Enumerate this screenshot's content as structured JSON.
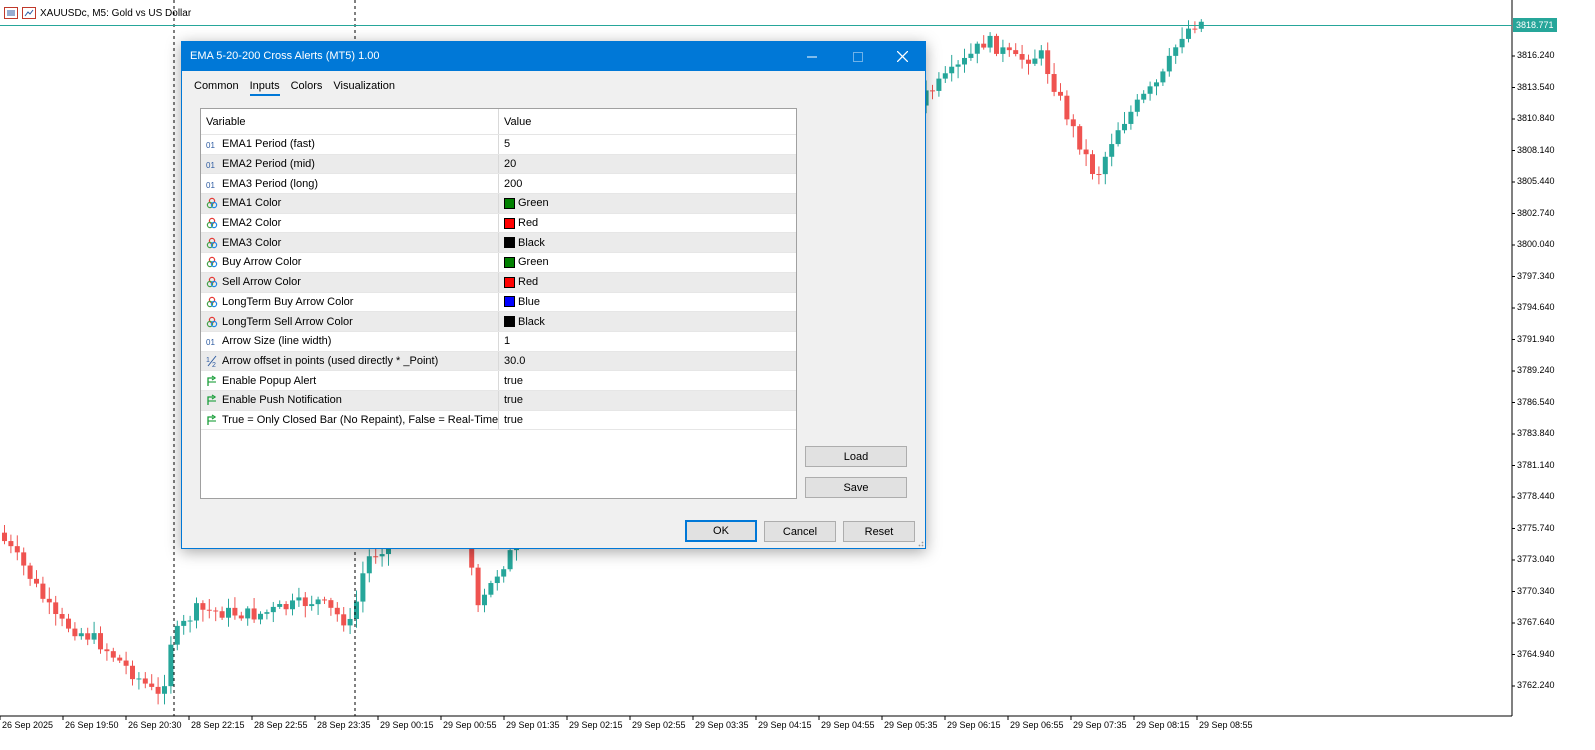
{
  "chart": {
    "title": "XAUUSDc, M5:  Gold vs US Dollar",
    "current_price": "3818.771",
    "price_axis": [
      "3816.240",
      "3813.540",
      "3810.840",
      "3808.140",
      "3805.440",
      "3802.740",
      "3800.040",
      "3797.340",
      "3794.640",
      "3791.940",
      "3789.240",
      "3786.540",
      "3783.840",
      "3781.140",
      "3778.440",
      "3775.740",
      "3773.040",
      "3770.340",
      "3767.640",
      "3764.940",
      "3762.240"
    ],
    "time_axis": [
      "26 Sep 2025",
      "26 Sep 19:50",
      "26 Sep 20:30",
      "28 Sep 22:15",
      "28 Sep 22:55",
      "28 Sep 23:35",
      "29 Sep 00:15",
      "29 Sep 00:55",
      "29 Sep 01:35",
      "29 Sep 02:15",
      "29 Sep 02:55",
      "29 Sep 03:35",
      "29 Sep 04:15",
      "29 Sep 04:55",
      "29 Sep 05:35",
      "29 Sep 06:15",
      "29 Sep 06:55",
      "29 Sep 07:35",
      "29 Sep 08:15",
      "29 Sep 08:55"
    ],
    "bull_color": "#26a69a",
    "bear_color": "#ef5350"
  },
  "dialog": {
    "title": "EMA 5-20-200 Cross Alerts (MT5) 1.00",
    "tabs": [
      "Common",
      "Inputs",
      "Colors",
      "Visualization"
    ],
    "active_tab": "Inputs",
    "columns": {
      "variable": "Variable",
      "value": "Value"
    },
    "inputs": [
      {
        "type": "int",
        "name": "EMA1 Period (fast)",
        "value": "5"
      },
      {
        "type": "int",
        "name": "EMA2 Period (mid)",
        "value": "20"
      },
      {
        "type": "int",
        "name": "EMA3 Period (long)",
        "value": "200"
      },
      {
        "type": "color",
        "name": "EMA1 Color",
        "value": "Green",
        "color": "#008000"
      },
      {
        "type": "color",
        "name": "EMA2 Color",
        "value": "Red",
        "color": "#ff0000"
      },
      {
        "type": "color",
        "name": "EMA3 Color",
        "value": "Black",
        "color": "#000000"
      },
      {
        "type": "color",
        "name": "Buy Arrow Color",
        "value": "Green",
        "color": "#008000"
      },
      {
        "type": "color",
        "name": "Sell Arrow Color",
        "value": "Red",
        "color": "#ff0000"
      },
      {
        "type": "color",
        "name": "LongTerm Buy Arrow Color",
        "value": "Blue",
        "color": "#0000ff"
      },
      {
        "type": "color",
        "name": "LongTerm Sell Arrow Color",
        "value": "Black",
        "color": "#000000"
      },
      {
        "type": "int",
        "name": "Arrow Size (line width)",
        "value": "1"
      },
      {
        "type": "double",
        "name": "Arrow offset in points (used directly * _Point)",
        "value": "30.0"
      },
      {
        "type": "bool",
        "name": "Enable Popup Alert",
        "value": "true"
      },
      {
        "type": "bool",
        "name": "Enable Push Notification",
        "value": "true"
      },
      {
        "type": "bool",
        "name": "True = Only Closed Bar (No Repaint), False = Real-Time",
        "value": "true"
      }
    ],
    "load_label": "Load",
    "save_label": "Save",
    "ok_label": "OK",
    "cancel_label": "Cancel",
    "reset_label": "Reset"
  }
}
